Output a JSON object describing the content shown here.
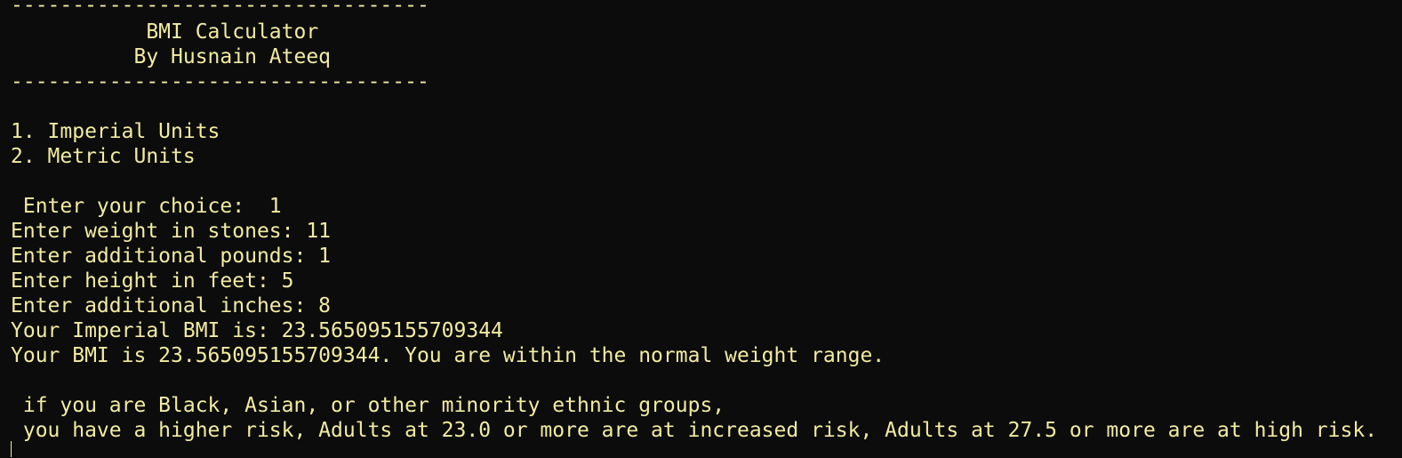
{
  "terminal": {
    "lines": {
      "l00": "----------------------------------",
      "l01": "           BMI Calculator",
      "l02": "          By Husnain Ateeq",
      "l03": "----------------------------------",
      "l04": "",
      "l05": "1. Imperial Units",
      "l06": "2. Metric Units",
      "l07": "",
      "l08": " Enter your choice:  1",
      "l09": "Enter weight in stones: 11",
      "l10": "Enter additional pounds: 1",
      "l11": "Enter height in feet: 5",
      "l12": "Enter additional inches: 8",
      "l13": "Your Imperial BMI is: 23.565095155709344",
      "l14": "Your BMI is 23.565095155709344. You are within the normal weight range.",
      "l15": "",
      "l16": " if you are Black, Asian, or other minority ethnic groups,",
      "l17": " you have a higher risk, Adults at 23.0 or more are at increased risk, Adults at 27.5 or more are at high risk."
    }
  },
  "colors": {
    "background": "#0c0c0c",
    "foreground": "#f2eba0"
  }
}
